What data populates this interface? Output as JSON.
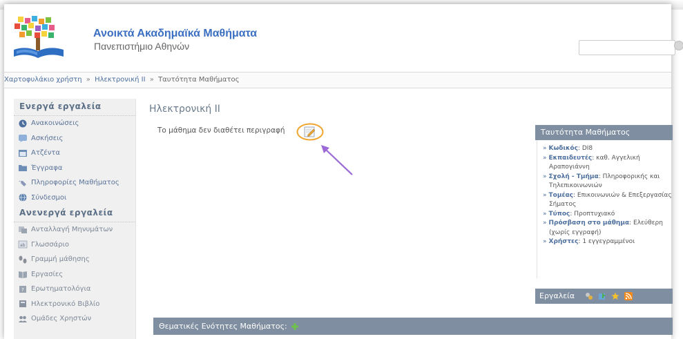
{
  "site": {
    "title": "Ανοικτά Ακαδημαϊκά Μαθήματα",
    "subtitle": "Πανεπιστήμιο Αθηνών",
    "search_placeholder": ""
  },
  "breadcrumb": {
    "items": [
      "Χαρτοφυλάκιο χρήστη",
      "Ηλεκτρονική ΙΙ"
    ],
    "separator": "»",
    "current": "Ταυτότητα Μαθήματος"
  },
  "sidebar": {
    "active_heading": "Ενεργά εργαλεία",
    "active_items": [
      {
        "label": "Ανακοινώσεις",
        "icon": "announcements-icon"
      },
      {
        "label": "Ασκήσεις",
        "icon": "exercises-icon"
      },
      {
        "label": "Ατζέντα",
        "icon": "agenda-icon"
      },
      {
        "label": "Έγγραφα",
        "icon": "documents-icon"
      },
      {
        "label": "Πληροφορίες Μαθήματος",
        "icon": "course-info-icon"
      },
      {
        "label": "Σύνδεσμοι",
        "icon": "links-icon"
      }
    ],
    "inactive_heading": "Ανενεργά εργαλεία",
    "inactive_items": [
      {
        "label": "Ανταλλαγή Μηνυμάτων",
        "icon": "message-exchange-icon"
      },
      {
        "label": "Γλωσσάριο",
        "icon": "glossary-icon"
      },
      {
        "label": "Γραμμή μάθησης",
        "icon": "learning-path-icon"
      },
      {
        "label": "Εργασίες",
        "icon": "assignments-icon"
      },
      {
        "label": "Ερωτηματολόγια",
        "icon": "questionnaires-icon"
      },
      {
        "label": "Ηλεκτρονικό Βιβλίο",
        "icon": "ebook-icon"
      },
      {
        "label": "Ομάδες Χρηστών",
        "icon": "user-groups-icon"
      }
    ]
  },
  "main": {
    "course_title": "Ηλεκτρονική ΙΙ",
    "description": "Το μάθημα δεν διαθέτει περιγραφή",
    "topics_label": "Θεματικές Ενότητες Μαθήματος:"
  },
  "info_panel": {
    "title": "Ταυτότητα Μαθήματος",
    "rows": [
      {
        "label": "Κωδικός",
        "value": "DI8"
      },
      {
        "label": "Εκπαιδευτές",
        "value": "καθ. Αγγελική Αραπογιάννη"
      },
      {
        "label": "Σχολή - Τμήμα",
        "value": "Πληροφορικής και Τηλεπικοινωνιών"
      },
      {
        "label": "Τομέας",
        "value": "Επικοινωνιών & Επεξεργασίας Σήματος"
      },
      {
        "label": "Τύπος",
        "value": "Προπτυχιακό"
      },
      {
        "label": "Πρόσβαση στο μάθημα",
        "value": "Ελεύθερη (χωρίς εγγραφή)"
      },
      {
        "label": "Χρήστες",
        "value": "1 εγγεγραμμένοι"
      }
    ]
  },
  "tools": {
    "label": "Εργαλεία",
    "icons": [
      "manage-tools-icon",
      "export-icon",
      "favorite-star-icon",
      "rss-icon"
    ]
  },
  "colors": {
    "accent": "#3a6fc2",
    "bar": "#7f8ea0",
    "link": "#4d6f9e",
    "highlight": "#f0a52e",
    "arrow": "#9b6ad6"
  }
}
